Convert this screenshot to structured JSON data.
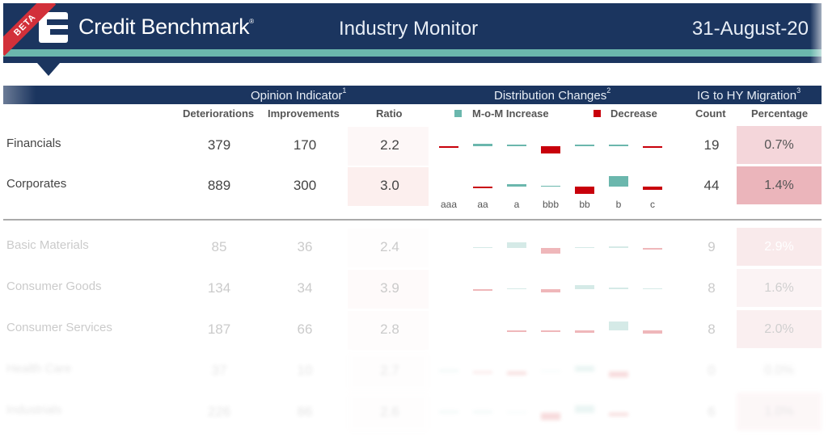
{
  "header": {
    "beta_label": "BETA",
    "brand": "Credit Benchmark",
    "brand_mark": "®",
    "title": "Industry Monitor",
    "date": "31-August-20"
  },
  "sections": {
    "opinion": "Opinion Indicator",
    "opinion_note": "1",
    "distribution": "Distribution Changes",
    "distribution_note": "2",
    "migration": "IG to HY Migration",
    "migration_note": "3"
  },
  "columns": {
    "deteriorations": "Deteriorations",
    "improvements": "Improvements",
    "ratio": "Ratio",
    "increase": "M-o-M Increase",
    "decrease": "Decrease",
    "count": "Count",
    "percentage": "Percentage"
  },
  "colors": {
    "navy": "#1b355f",
    "teal": "#6bb7ad",
    "increase": "#6bb7ad",
    "decrease": "#c8000b",
    "beta": "#d2303a"
  },
  "grades": [
    "aaa",
    "aa",
    "a",
    "bbb",
    "bb",
    "b",
    "c"
  ],
  "rows": [
    {
      "name": "Financials",
      "deteriorations": "379",
      "improvements": "170",
      "ratio": "2.2",
      "count": "19",
      "percentage": "0.7%",
      "changes": [
        -0.5,
        1.5,
        0.8,
        -4,
        0.8,
        1,
        -0.5
      ]
    },
    {
      "name": "Corporates",
      "deteriorations": "889",
      "improvements": "300",
      "ratio": "3.0",
      "count": "44",
      "percentage": "1.4%",
      "changes": [
        0,
        -1,
        1.5,
        0.3,
        -4,
        6,
        -2
      ]
    },
    {
      "name": "Basic Materials",
      "deteriorations": "85",
      "improvements": "36",
      "ratio": "2.4",
      "count": "9",
      "percentage": "2.9%",
      "changes": [
        0,
        0.3,
        3,
        -3,
        0.3,
        1,
        -0.5
      ]
    },
    {
      "name": "Consumer Goods",
      "deteriorations": "134",
      "improvements": "34",
      "ratio": "3.9",
      "count": "8",
      "percentage": "1.6%",
      "changes": [
        0,
        -0.8,
        0.3,
        -2,
        2.5,
        1,
        0.2
      ]
    },
    {
      "name": "Consumer Services",
      "deteriorations": "187",
      "improvements": "66",
      "ratio": "2.8",
      "count": "8",
      "percentage": "2.0%",
      "changes": [
        0,
        0,
        -0.5,
        -1,
        -1.5,
        5,
        -2
      ]
    },
    {
      "name": "Health Care",
      "deteriorations": "37",
      "improvements": "10",
      "ratio": "2.7",
      "count": "0",
      "percentage": "0.0%",
      "changes": [
        1,
        -1,
        -2,
        0.3,
        3,
        -3,
        0
      ]
    },
    {
      "name": "Industrials",
      "deteriorations": "226",
      "improvements": "86",
      "ratio": "2.6",
      "count": "6",
      "percentage": "1.0%",
      "changes": [
        1,
        1,
        0.5,
        -4,
        4,
        -2,
        0
      ]
    }
  ]
}
